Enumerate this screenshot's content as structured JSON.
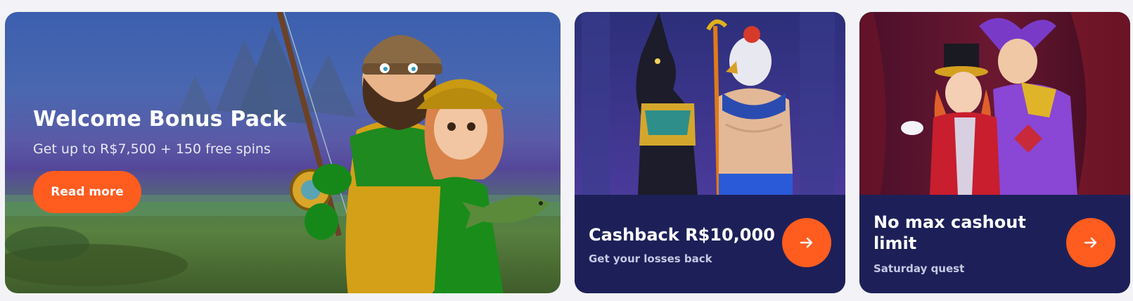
{
  "hero": {
    "title": "Welcome Bonus Pack",
    "subtitle": "Get up to R$7,500 + 150 free spins",
    "button_label": "Read more"
  },
  "cards": [
    {
      "title": "Cashback R$10,000",
      "subtitle": "Get your losses back",
      "icon": "arrow-right-icon"
    },
    {
      "title_line1": "No max cashout",
      "title_line2": "limit",
      "subtitle": "Saturday quest",
      "icon": "arrow-right-icon"
    }
  ],
  "colors": {
    "page_bg": "#f3f3f7",
    "accent": "#ff5c1f",
    "card_navy": "#1e225a"
  }
}
